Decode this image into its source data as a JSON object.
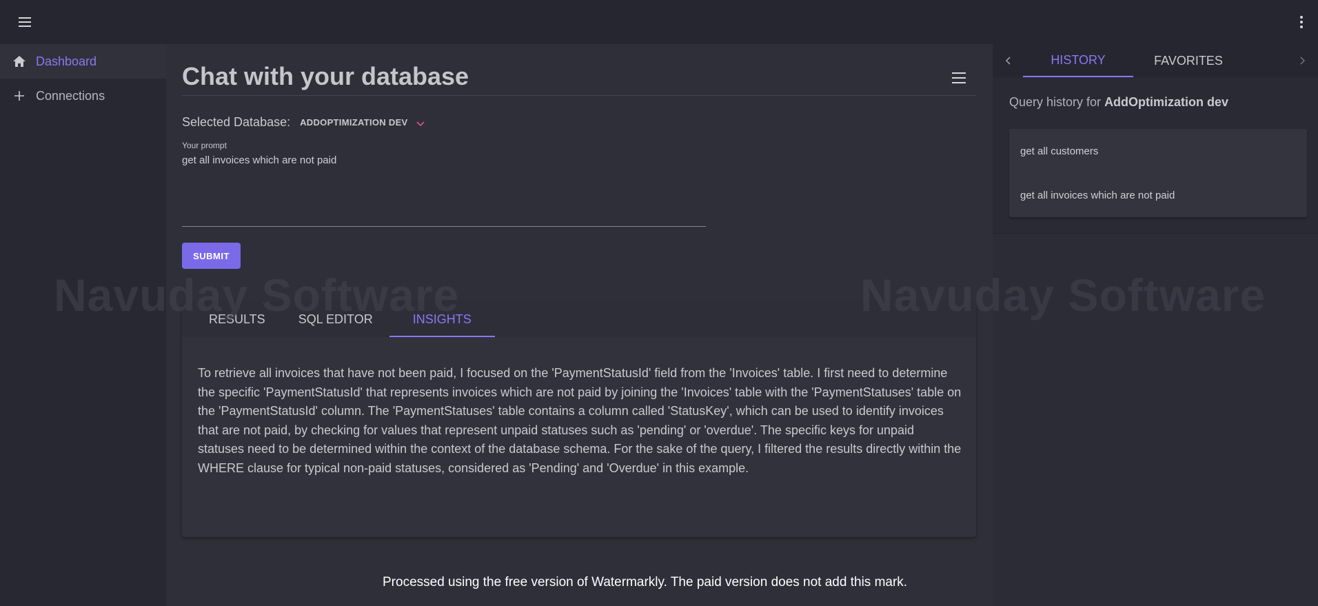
{
  "topbar": {
    "menu_icon": "hamburger-menu-icon",
    "more_icon": "more-vert-icon"
  },
  "sidebar": {
    "items": [
      {
        "label": "Dashboard",
        "icon": "home-icon",
        "active": true
      },
      {
        "label": "Connections",
        "icon": "plus-icon",
        "active": false
      }
    ]
  },
  "main": {
    "title": "Chat with your database",
    "selected_db_label": "Selected Database:",
    "selected_db_value": "ADDOPTIMIZATION DEV",
    "prompt_label": "Your prompt",
    "prompt_value": "get all invoices which are not paid",
    "submit_label": "SUBMIT",
    "tabs": [
      {
        "label": "RESULTS",
        "active": false
      },
      {
        "label": "SQL EDITOR",
        "active": false
      },
      {
        "label": "INSIGHTS",
        "active": true
      }
    ],
    "insights": "To retrieve all invoices that have not been paid, I focused on the 'PaymentStatusId' field from the 'Invoices' table. I first need to determine the specific 'PaymentStatusId' that represents invoices which are not paid by joining the 'Invoices' table with the 'PaymentStatuses' table on the 'PaymentStatusId' column. The 'PaymentStatuses' table contains a column called 'StatusKey', which can be used to identify invoices that are not paid, by checking for values that represent unpaid statuses such as 'pending' or 'overdue'. The specific keys for unpaid statuses need to be determined within the context of the database schema. For the sake of the query, I filtered the results directly within the WHERE clause for typical non-paid statuses, considered as 'Pending' and 'Overdue' in this example."
  },
  "right_panel": {
    "tabs": [
      {
        "label": "HISTORY",
        "active": true
      },
      {
        "label": "FAVORITES",
        "active": false
      }
    ],
    "history_prefix": "Query history for",
    "history_db": "AddOptimization dev",
    "history_items": [
      "get all customers",
      "get all invoices which are not paid"
    ]
  },
  "watermark": {
    "text": "Navuday Software"
  },
  "footer_note": "Processed using the free version of Watermarkly. The paid version does not add this mark.",
  "colors": {
    "accent": "#7b6ae8",
    "accent_text": "#8b78f0",
    "chevron": "#e0557a",
    "background": "#2b2b36"
  }
}
